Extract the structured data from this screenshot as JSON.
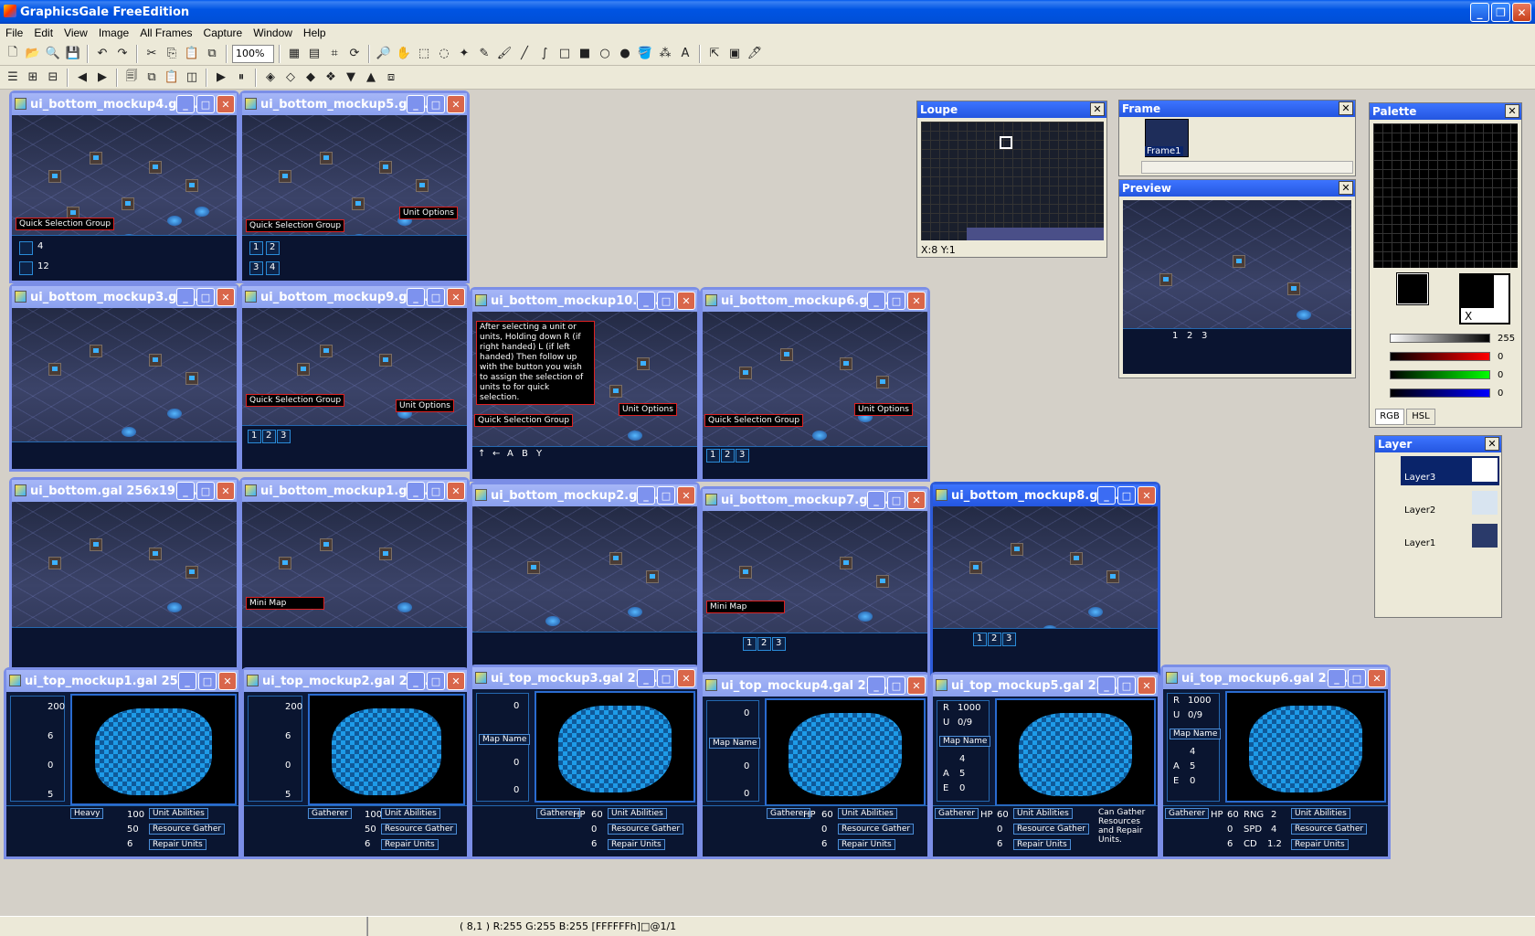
{
  "app": {
    "title": "GraphicsGale FreeEdition"
  },
  "menu": [
    "File",
    "Edit",
    "View",
    "Image",
    "All Frames",
    "Capture",
    "Window",
    "Help"
  ],
  "toolbar": {
    "zoom": "100%"
  },
  "status": {
    "text": "( 8,1 ) R:255 G:255 B:255  [FFFFFFh]□@1/1"
  },
  "windows": [
    {
      "title": "ui_bottom_mockup4.ga...",
      "callouts": [
        "Quick Selection Group"
      ],
      "nums": [
        "4",
        "12"
      ]
    },
    {
      "title": "ui_bottom_mockup5.ga...",
      "callouts": [
        "Quick Selection Group",
        "Unit Options"
      ],
      "nums": [
        "1",
        "2",
        "3",
        "4"
      ]
    },
    {
      "title": "ui_bottom_mockup3.ga...",
      "callouts": [],
      "nums": []
    },
    {
      "title": "ui_bottom_mockup9.ga...",
      "callouts": [
        "Quick Selection Group",
        "Unit Options"
      ],
      "nums": [
        "1",
        "2",
        "3"
      ]
    },
    {
      "title": "ui_bottom_mockup10.g...",
      "callouts": [
        "Quick Selection Group",
        "Unit Options"
      ],
      "nums": []
    },
    {
      "title": "ui_bottom_mockup6.ga...",
      "callouts": [
        "Quick Selection Group",
        "Unit Options"
      ],
      "nums": [
        "1",
        "2",
        "3"
      ]
    },
    {
      "title": "ui_bottom.gal 256x192...",
      "callouts": [],
      "nums": []
    },
    {
      "title": "ui_bottom_mockup1.ga...",
      "callouts": [
        "Mini Map"
      ],
      "nums": []
    },
    {
      "title": "ui_bottom_mockup2.ga...",
      "callouts": [],
      "nums": []
    },
    {
      "title": "ui_bottom_mockup7.ga...",
      "callouts": [
        "Mini Map"
      ],
      "nums": [
        "1",
        "2",
        "3"
      ]
    },
    {
      "title": "ui_bottom_mockup8.ga...",
      "callouts": [],
      "nums": [
        "1",
        "2",
        "3"
      ]
    }
  ],
  "mockup10_note": "After selecting a unit or units, Holding down R (if right handed) L (if left handed) Then follow up with the button you wish to assign the selection of units to for quick selection.",
  "mockup10_keys": [
    "↑",
    "←",
    "A",
    "B",
    "Y"
  ],
  "top_windows": [
    {
      "title": "ui_top_mockup1.gal 25...",
      "nums": [
        "200",
        "6",
        "0",
        "5"
      ],
      "unit": "Heavy",
      "stats": [
        "100",
        "50",
        "6"
      ],
      "abilities": [
        "Unit Abilities",
        "Resource Gather",
        "Repair Units"
      ]
    },
    {
      "title": "ui_top_mockup2.gal 25...",
      "nums": [
        "200",
        "6",
        "0",
        "5"
      ],
      "unit": "Gatherer",
      "stats": [
        "100",
        "50",
        "6"
      ],
      "abilities": [
        "Unit Abilities",
        "Resource Gather",
        "Repair Units"
      ]
    },
    {
      "title": "ui_top_mockup3.gal 25...",
      "nums": [
        "0",
        "0",
        "0",
        "0"
      ],
      "unit": "Gatherer",
      "stats": [
        "HP",
        "60",
        "0",
        "6"
      ],
      "abilities": [
        "Unit Abilities",
        "Resource Gather",
        "Repair Units"
      ],
      "label": "Map Name"
    },
    {
      "title": "ui_top_mockup4.gal 25...",
      "nums": [
        "0",
        "0",
        "0",
        "0"
      ],
      "unit": "Gatherer",
      "stats": [
        "HP",
        "60",
        "0",
        "6"
      ],
      "abilities": [
        "Unit Abilities",
        "Resource Gather",
        "Repair Units"
      ],
      "label": "Map Name"
    },
    {
      "title": "ui_top_mockup5.gal 25...",
      "nums": [
        "R",
        "1000",
        "U",
        "0/9",
        "4",
        "A",
        "5",
        "E",
        "0"
      ],
      "unit": "Gatherer",
      "stats": [
        "HP",
        "60",
        "0",
        "6"
      ],
      "abilities": [
        "Unit Abilities",
        "Resource Gather",
        "Repair Units"
      ],
      "label": "Map Name",
      "extra": "Can Gather Resources and Repair Units."
    },
    {
      "title": "ui_top_mockup6.gal 25...",
      "nums": [
        "R",
        "1000",
        "U",
        "0/9",
        "4",
        "A",
        "5",
        "E",
        "0"
      ],
      "unit": "Gatherer",
      "stats": [
        "HP",
        "60",
        "0",
        "6",
        "RNG",
        "2",
        "SPD",
        "4",
        "CD",
        "1.2"
      ],
      "abilities": [
        "Unit Abilities",
        "Resource Gather",
        "Repair Units"
      ],
      "label": "Map Name"
    }
  ],
  "loupe": {
    "title": "Loupe",
    "coords": "X:8 Y:1"
  },
  "frame": {
    "title": "Frame",
    "item": "Frame1"
  },
  "preview": {
    "title": "Preview",
    "nums": [
      "1",
      "2",
      "3"
    ]
  },
  "palette": {
    "title": "Palette",
    "values": [
      "255",
      "0",
      "0",
      "0"
    ],
    "tabs": [
      "RGB",
      "HSL"
    ],
    "swatch_label": "X"
  },
  "layer": {
    "title": "Layer",
    "items": [
      "Layer3",
      "Layer2",
      "Layer1"
    ]
  },
  "colors": {
    "titlebar": "#0054e3",
    "workspace": "#d4d0c8",
    "ui_blue": "#1e9be8",
    "ui_dark": "#0a1430"
  }
}
